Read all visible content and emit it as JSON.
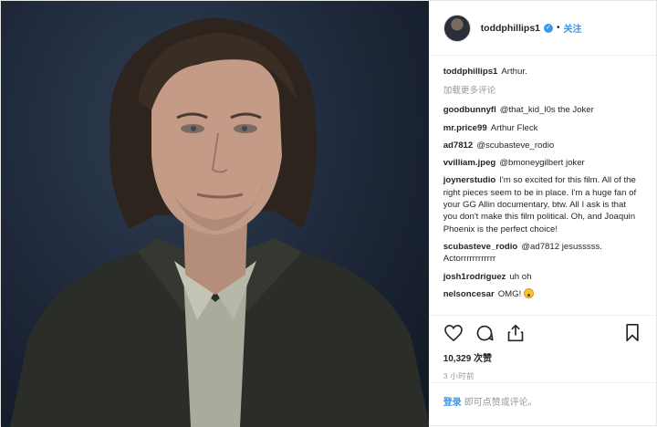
{
  "header": {
    "username": "toddphillips1",
    "separator": "•",
    "follow_label": "关注"
  },
  "caption": {
    "username": "toddphillips1",
    "text": "Arthur."
  },
  "load_more_label": "加载更多评论",
  "comments": [
    {
      "username": "goodbunnyfl",
      "text": "@that_kid_l0s the Joker"
    },
    {
      "username": "mr.price99",
      "text": "Arthur Fleck"
    },
    {
      "username": "ad7812",
      "text": "@scubasteve_rodio"
    },
    {
      "username": "vvilliam.jpeg",
      "text": "@bmoneygilbert joker"
    },
    {
      "username": "joynerstudio",
      "text": "I'm so excited for this film. All of the right pieces seem to be in place. I'm a huge fan of your GG Allin documentary, btw. All I ask is that you don't make this film political. Oh, and Joaquin Phoenix is the perfect choice!"
    },
    {
      "username": "scubasteve_rodio",
      "text": "@ad7812 jesusssss. Actorrrrrrrrrrrr"
    },
    {
      "username": "josh1rodriguez",
      "text": "uh oh"
    },
    {
      "username": "nelsoncesar",
      "text": "OMG!",
      "emoji": "astonished-face-emoji"
    }
  ],
  "likes_label": "10,329 次赞",
  "timestamp": "3 小时前",
  "login_bar": {
    "login_label": "登录",
    "rest_text": "即可点赞或评论。"
  },
  "icons": [
    "heart-icon",
    "comment-icon",
    "share-icon",
    "bookmark-icon",
    "verified-icon"
  ],
  "colors": {
    "link_blue": "#3897f0",
    "muted": "#999999",
    "text": "#262626",
    "border": "#efefef"
  }
}
